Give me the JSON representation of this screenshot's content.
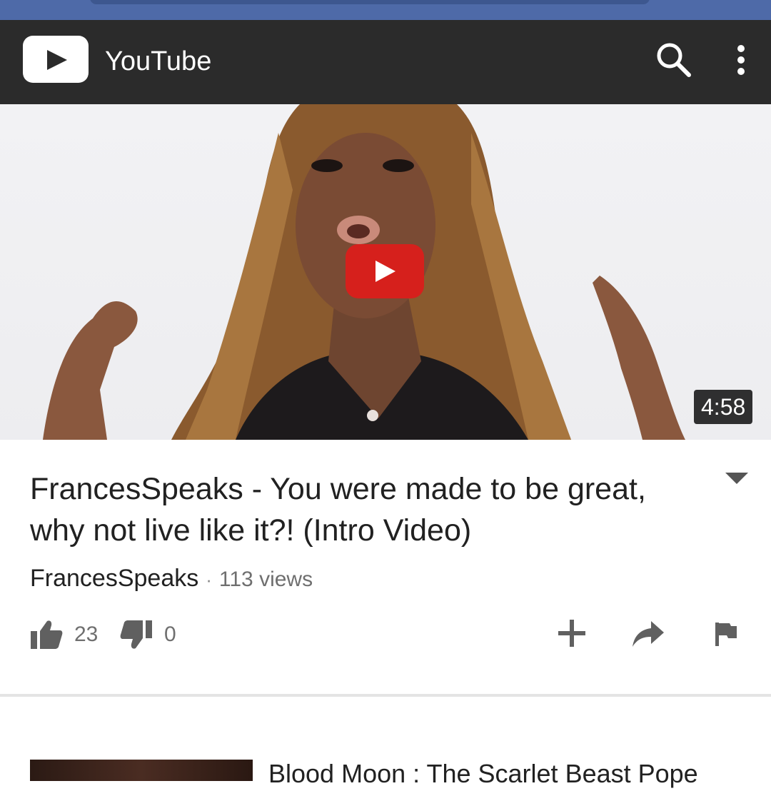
{
  "app": {
    "title": "YouTube"
  },
  "video": {
    "duration": "4:58",
    "title": "FrancesSpeaks - You were made to be great, why not live like it?! (Intro Video)",
    "channel": "FrancesSpeaks",
    "separator": "·",
    "views": "113 views",
    "likes": "23",
    "dislikes": "0"
  },
  "next_video": {
    "title": "Blood Moon : The Scarlet Beast Pope"
  },
  "colors": {
    "appbar": "#2b2b2b",
    "play_button": "#d6201c",
    "top_strip": "#4e6aa8"
  },
  "icons": {
    "logo": "youtube-logo-icon",
    "search": "search-icon",
    "more": "more-vert-icon",
    "play": "play-icon",
    "expand": "expand-triangle-icon",
    "like": "thumbs-up-icon",
    "dislike": "thumbs-down-icon",
    "add": "add-to-playlist-icon",
    "share": "share-icon",
    "flag": "flag-icon"
  }
}
